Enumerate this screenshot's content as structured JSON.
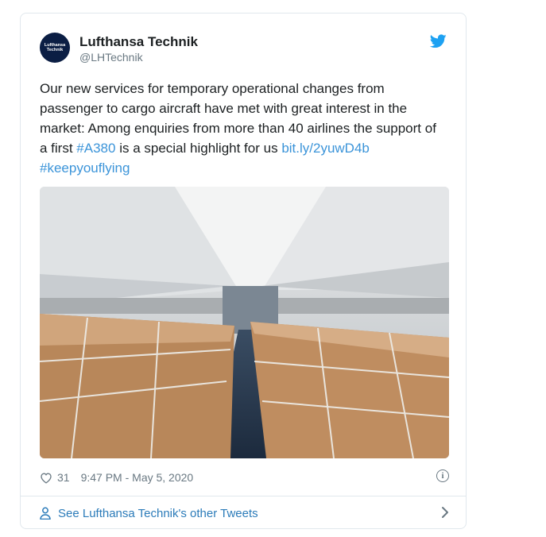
{
  "tweet": {
    "author_name": "Lufthansa Technik",
    "author_handle": "@LHTechnik",
    "avatar_text_line1": "Lufthansa",
    "avatar_text_line2": "Technik",
    "text_part1": "Our new services for temporary operational changes from passenger to cargo aircraft have met with great interest in the market: Among enquiries from more than 40 airlines the support of a first ",
    "hashtag1": "#A380",
    "text_part2": " is a special highlight for us ",
    "link": "bit.ly/2yuwD4b",
    "hashtag2": "#keepyouflying",
    "likes": "31",
    "timestamp": "9:47 PM - May 5, 2020",
    "info_glyph": "i"
  },
  "footer": {
    "label": "See Lufthansa Technik's other Tweets"
  },
  "colors": {
    "link": "#3b94d9",
    "twitter_blue": "#1da1f2",
    "avatar_bg": "#0b1e44",
    "muted": "#697882"
  },
  "icons": {
    "brand": "twitter-bird-icon",
    "like": "heart-icon",
    "info": "info-icon",
    "profile": "person-icon",
    "more": "chevron-right-icon"
  }
}
